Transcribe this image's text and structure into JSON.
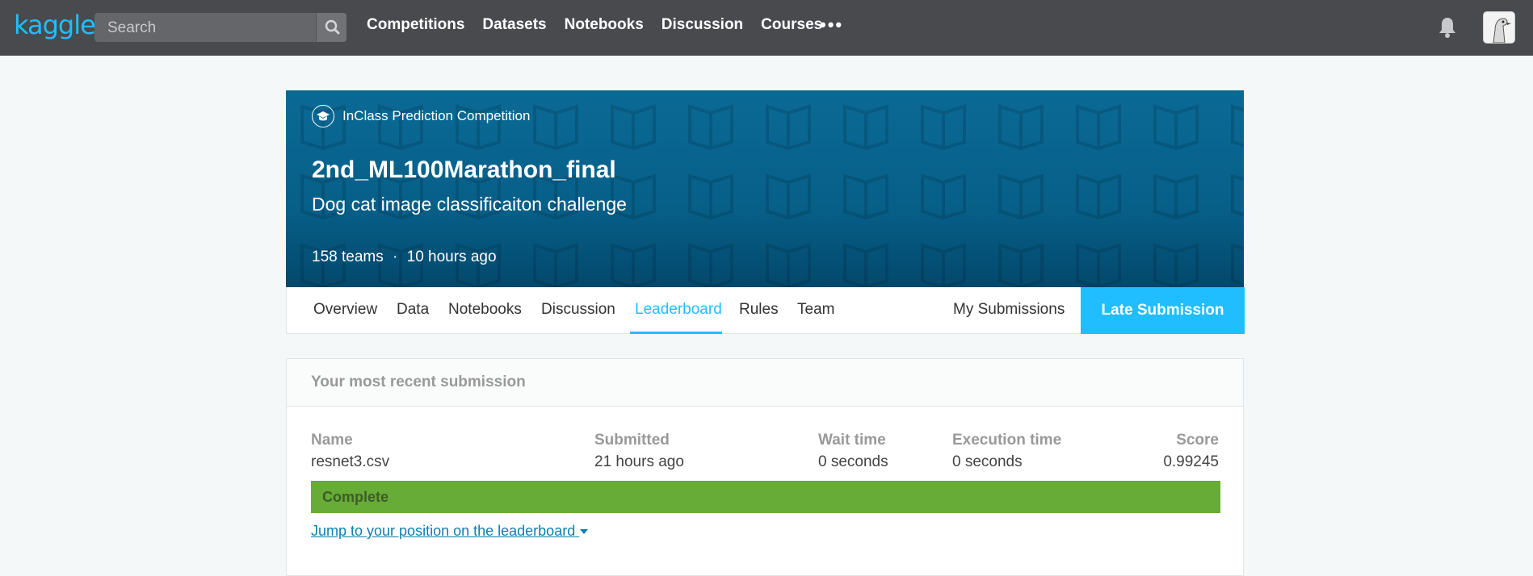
{
  "topbar": {
    "logo": "kaggle",
    "search_placeholder": "Search",
    "nav": [
      "Competitions",
      "Datasets",
      "Notebooks",
      "Discussion",
      "Courses"
    ],
    "more": "•••"
  },
  "banner": {
    "comp_type": "InClass Prediction Competition",
    "title": "2nd_ML100Marathon_final",
    "subtitle": "Dog cat image classificaiton challenge",
    "teams": "158 teams",
    "separator": "·",
    "time_ago": "10 hours ago",
    "color": "#0a6a95"
  },
  "tabs": {
    "items": [
      "Overview",
      "Data",
      "Notebooks",
      "Discussion",
      "Leaderboard",
      "Rules",
      "Team"
    ],
    "active": "Leaderboard",
    "my_submissions": "My Submissions",
    "late_submission": "Late Submission"
  },
  "submission": {
    "heading": "Your most recent submission",
    "columns": {
      "name": {
        "label": "Name",
        "value": "resnet3.csv"
      },
      "submitted": {
        "label": "Submitted",
        "value": "21 hours ago"
      },
      "wait": {
        "label": "Wait time",
        "value": "0 seconds"
      },
      "exec": {
        "label": "Execution time",
        "value": "0 seconds"
      },
      "score": {
        "label": "Score",
        "value": "0.99245"
      }
    },
    "status": "Complete",
    "status_color": "#67ac36",
    "jump_link": "Jump to your position on the leaderboard"
  },
  "colors": {
    "accent": "#20beff",
    "topbar": "#484a4e"
  }
}
